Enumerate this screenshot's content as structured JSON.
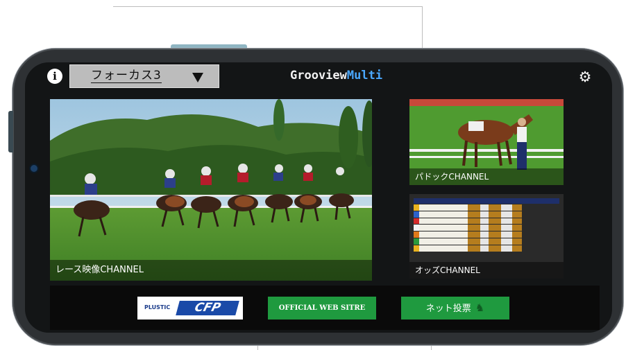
{
  "header": {
    "channel_value": "フォーカス3",
    "app_title_main": "Grooview",
    "app_title_accent": "Multi"
  },
  "panels": {
    "main_label": "レース映像CHANNEL",
    "paddock_label": "パドックCHANNEL",
    "odds_label": "オッズCHANNEL"
  },
  "footer": {
    "plus_prefix": "PLUSTIC",
    "plus_logo": "CFP",
    "official_label": "OFFICIAL WEB SITRE",
    "net_label": "ネット投票"
  },
  "icons": {
    "info": "info-icon",
    "gear": "gear-icon",
    "dropdown": "triangle-down-icon",
    "horse": "horse-icon"
  },
  "colors": {
    "accent_blue": "#4aa8ff",
    "button_green": "#1f9a3f",
    "logo_blue": "#1a4aa8"
  }
}
